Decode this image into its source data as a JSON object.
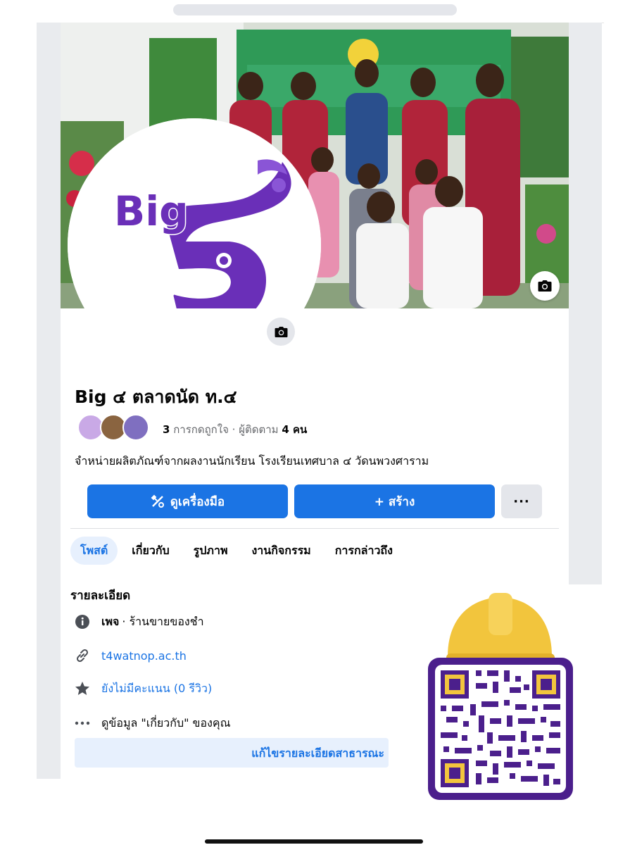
{
  "page": {
    "name": "Big ๔ ตลาดนัด ท.๔",
    "likes_count": "3",
    "likes_label": "การกดถูกใจ",
    "separator": "·",
    "followers_label": "ผู้ติดตาม",
    "followers_count": "4 คน",
    "about": "จำหน่ายผลิตภัณฑ์จากผลงานนักเรียน โรงเรียนเทศบาล ๔ วัดนพวงศาราม",
    "logo_text": "Big"
  },
  "buttons": {
    "tools_label": "ดูเครื่องมือ",
    "create_label": "+ สร้าง",
    "more_label": "···"
  },
  "tabs": [
    {
      "label": "โพสต์",
      "active": true
    },
    {
      "label": "เกี่ยวกับ"
    },
    {
      "label": "รูปภาพ"
    },
    {
      "label": "งานกิจกรรม"
    },
    {
      "label": "การกล่าวถึง"
    }
  ],
  "details": {
    "title": "รายละเอียด",
    "category_prefix": "เพจ",
    "category": "· ร้านขายของชำ",
    "website": "t4watnop.ac.th",
    "rating": "ยังไม่มีคะแนน (0 รีวิว)",
    "about_info": "ดูข้อมูล \"เกี่ยวกับ\" ของคุณ",
    "edit_label": "แก้ไขรายละเอียดสาธารณะ"
  },
  "icons": {
    "tools": "tools-icon",
    "info": "info-icon",
    "link": "link-icon",
    "star": "star-icon",
    "more": "more-dots-icon",
    "camera": "camera-icon"
  },
  "colors": {
    "brand_blue": "#1b74e4",
    "logo_purple": "#6a2fb8",
    "qr_purple": "#4b1f8c",
    "hat_yellow": "#f2c53d"
  }
}
